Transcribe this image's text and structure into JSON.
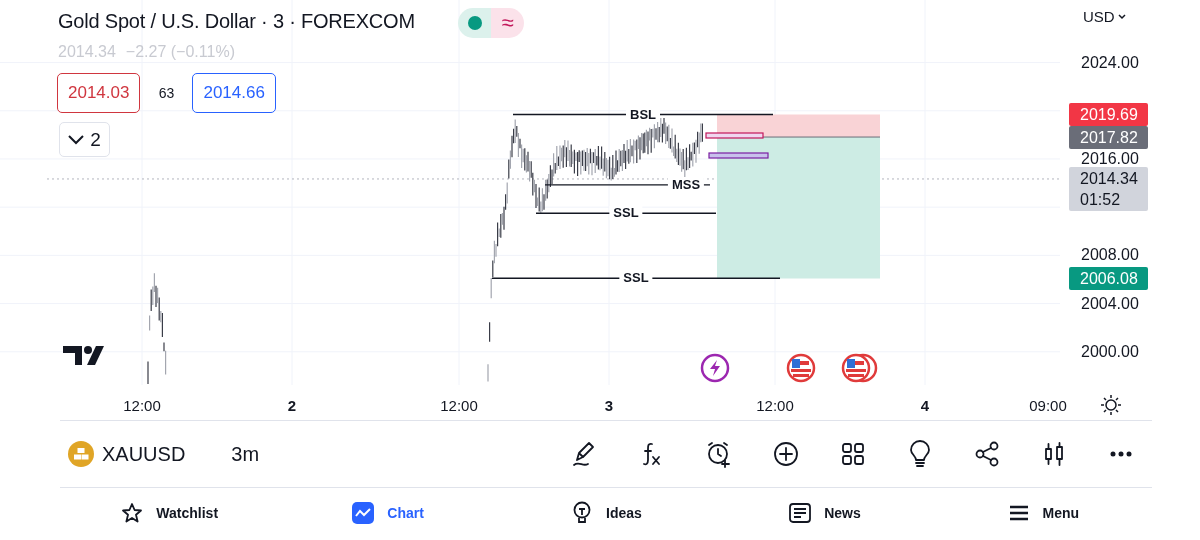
{
  "header": {
    "title": "Gold Spot / U.S. Dollar · 3 · FOREXCOM",
    "status_badge": {
      "market_open": true,
      "data_symbol": "≈"
    },
    "quote": {
      "price": "2014.34",
      "change": "−2.27 (−0.11%)"
    },
    "bid_ask": {
      "bid": "2014.03",
      "spread": "63",
      "ask": "2014.66"
    },
    "indicators_toggle": {
      "count": "2"
    }
  },
  "currency": "USD",
  "price_axis": [
    "2024.00",
    "2016.00",
    "2008.00",
    "2004.00",
    "2000.00"
  ],
  "price_tags": [
    {
      "kind": "stop",
      "value": "2019.69"
    },
    {
      "kind": "entry",
      "value": "2017.82"
    },
    {
      "kind": "last",
      "value": "2014.34",
      "countdown": "01:52"
    },
    {
      "kind": "target",
      "value": "2006.08"
    }
  ],
  "levels": [
    {
      "label": "BSL"
    },
    {
      "label": "MSS"
    },
    {
      "label": "SSL"
    },
    {
      "label": "SSL"
    }
  ],
  "events": [
    {
      "kind": "lightning"
    },
    {
      "kind": "us"
    },
    {
      "kind": "us_multiple"
    }
  ],
  "time_axis": [
    {
      "label": "12:00",
      "kind": "time"
    },
    {
      "label": "2",
      "kind": "day"
    },
    {
      "label": "12:00",
      "kind": "time"
    },
    {
      "label": "3",
      "kind": "day"
    },
    {
      "label": "12:00",
      "kind": "time"
    },
    {
      "label": "4",
      "kind": "day"
    },
    {
      "label": "09:00",
      "kind": "time"
    }
  ],
  "symbol_bar": {
    "symbol": "XAUUSD",
    "interval": "3m"
  },
  "nav": [
    {
      "label": "Watchlist",
      "selected": false
    },
    {
      "label": "Chart",
      "selected": true
    },
    {
      "label": "Ideas",
      "selected": false
    },
    {
      "label": "News",
      "selected": false
    },
    {
      "label": "Menu",
      "selected": false
    }
  ]
}
